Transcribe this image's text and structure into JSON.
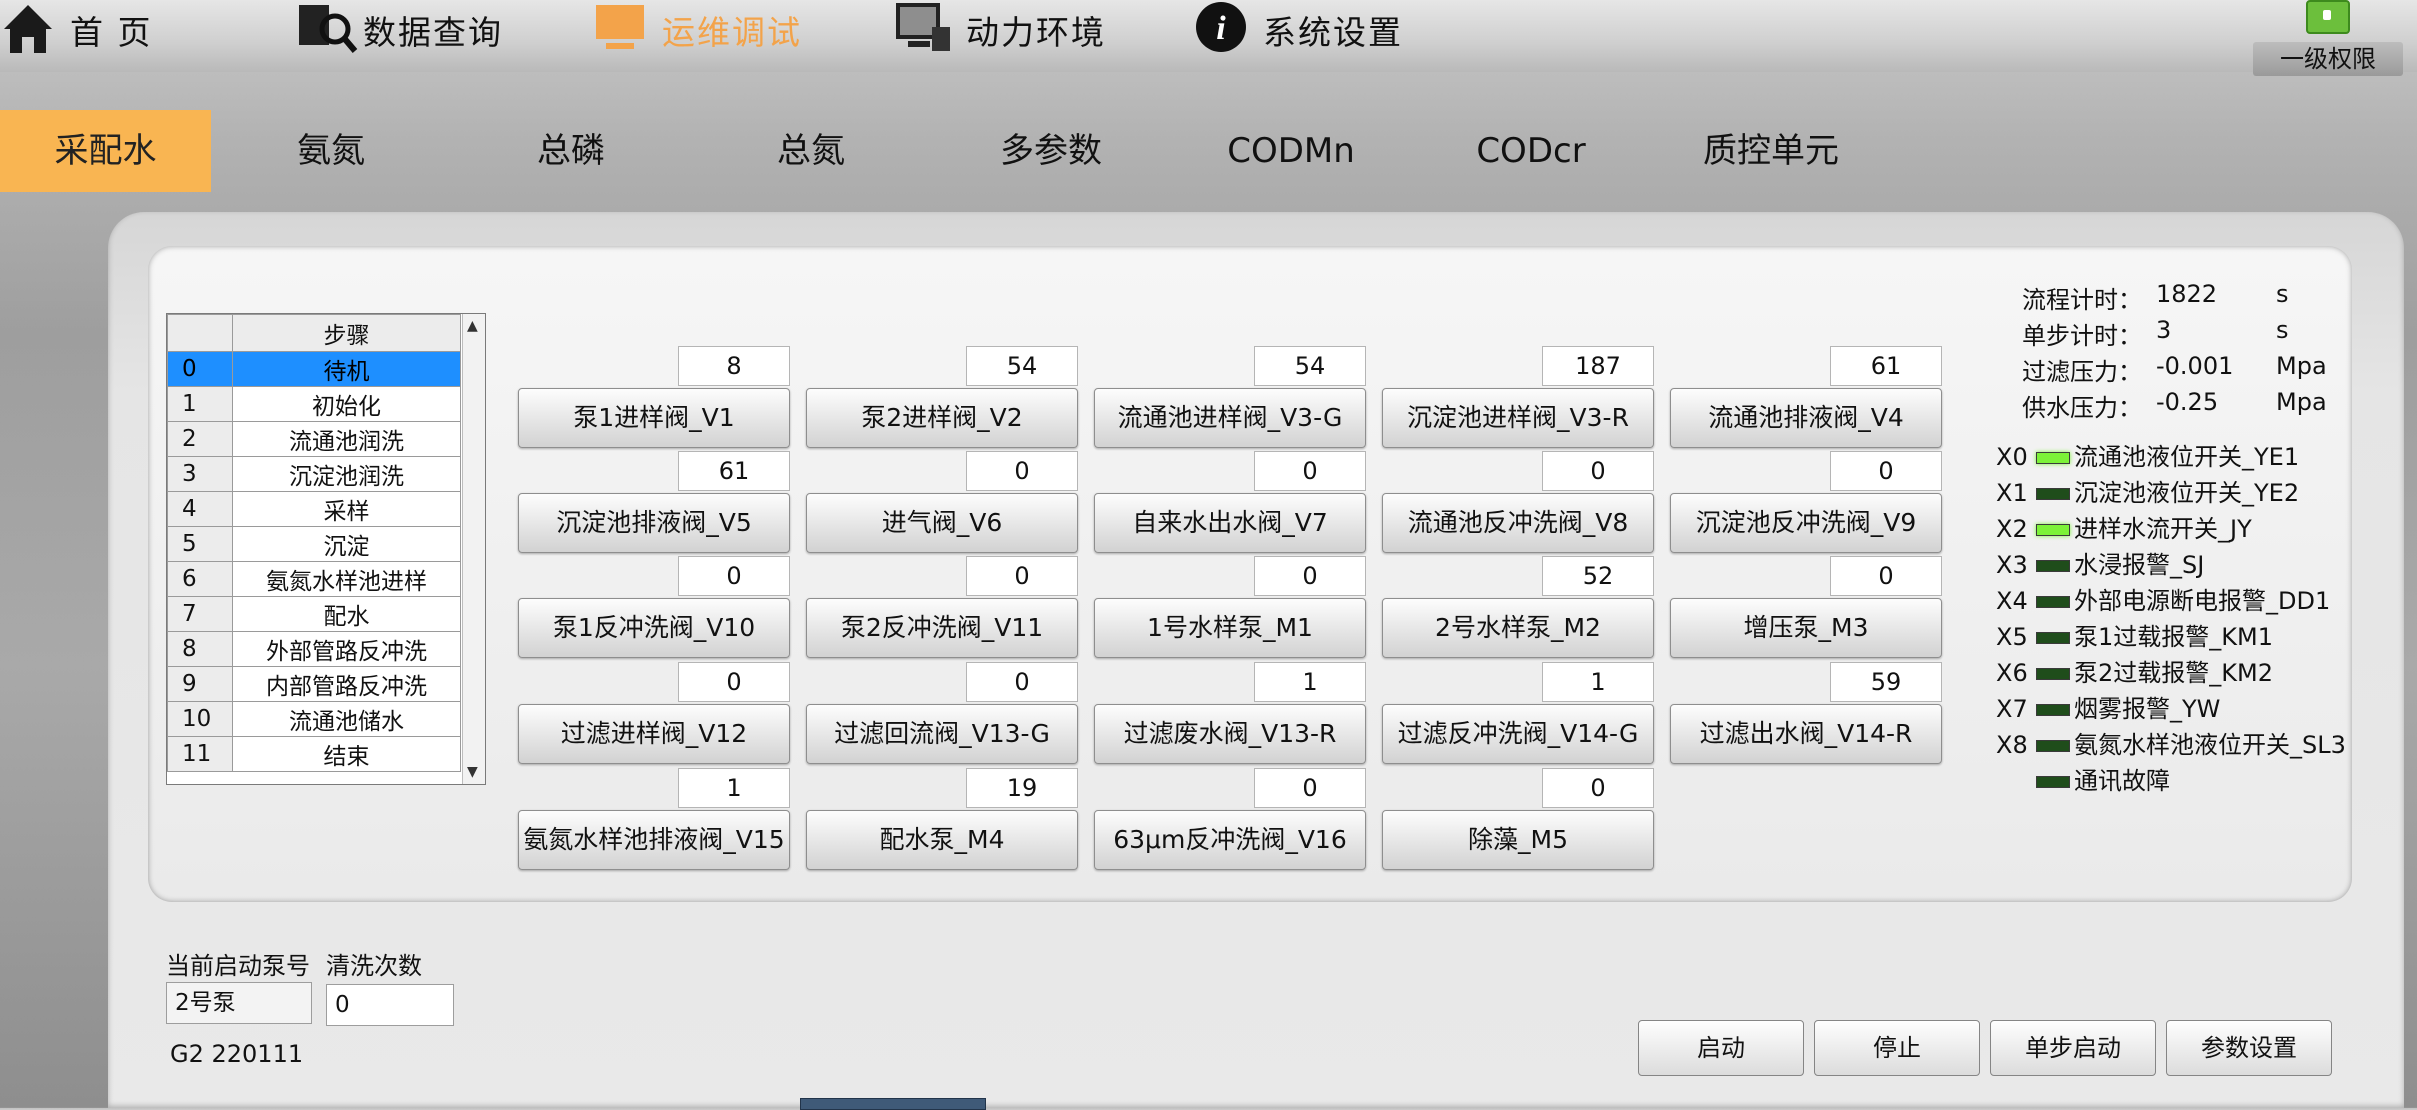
{
  "nav": {
    "items": [
      {
        "label": "首 页",
        "icon": "home-icon"
      },
      {
        "label": "数据查询",
        "icon": "data-search-icon"
      },
      {
        "label": "运维调试",
        "icon": "maintenance-icon",
        "active": true
      },
      {
        "label": "动力环境",
        "icon": "monitor-icon"
      },
      {
        "label": "系统设置",
        "icon": "info-icon"
      }
    ],
    "auth_label": "一级权限",
    "active_color": "#f3a34a"
  },
  "tabs": [
    "采配水",
    "氨氮",
    "总磷",
    "总氮",
    "多参数",
    "CODMn",
    "CODcr",
    "质控单元"
  ],
  "active_tab": "采配水",
  "steps": {
    "header": "步骤",
    "rows": [
      {
        "idx": "0",
        "name": "待机"
      },
      {
        "idx": "1",
        "name": "初始化"
      },
      {
        "idx": "2",
        "name": "流通池润洗"
      },
      {
        "idx": "3",
        "name": "沉淀池润洗"
      },
      {
        "idx": "4",
        "name": "采样"
      },
      {
        "idx": "5",
        "name": "沉淀"
      },
      {
        "idx": "6",
        "name": "氨氮水样池进样"
      },
      {
        "idx": "7",
        "name": "配水"
      },
      {
        "idx": "8",
        "name": "外部管路反冲洗"
      },
      {
        "idx": "9",
        "name": "内部管路反冲洗"
      },
      {
        "idx": "10",
        "name": "流通池储水"
      },
      {
        "idx": "11",
        "name": "结束"
      }
    ],
    "selected": "0",
    "selected_color": "#1e8fff"
  },
  "valves": [
    {
      "count": "8",
      "label": "泵1进样阀_V1"
    },
    {
      "count": "54",
      "label": "泵2进样阀_V2"
    },
    {
      "count": "54",
      "label": "流通池进样阀_V3-G"
    },
    {
      "count": "187",
      "label": "沉淀池进样阀_V3-R"
    },
    {
      "count": "61",
      "label": "流通池排液阀_V4"
    },
    {
      "count": "61",
      "label": "沉淀池排液阀_V5"
    },
    {
      "count": "0",
      "label": "进气阀_V6"
    },
    {
      "count": "0",
      "label": "自来水出水阀_V7"
    },
    {
      "count": "0",
      "label": "流通池反冲洗阀_V8"
    },
    {
      "count": "0",
      "label": "沉淀池反冲洗阀_V9"
    },
    {
      "count": "0",
      "label": "泵1反冲洗阀_V10"
    },
    {
      "count": "0",
      "label": "泵2反冲洗阀_V11"
    },
    {
      "count": "0",
      "label": "1号水样泵_M1"
    },
    {
      "count": "52",
      "label": "2号水样泵_M2"
    },
    {
      "count": "0",
      "label": "增压泵_M3"
    },
    {
      "count": "0",
      "label": "过滤进样阀_V12"
    },
    {
      "count": "0",
      "label": "过滤回流阀_V13-G"
    },
    {
      "count": "1",
      "label": "过滤废水阀_V13-R"
    },
    {
      "count": "1",
      "label": "过滤反冲洗阀_V14-G"
    },
    {
      "count": "59",
      "label": "过滤出水阀_V14-R"
    },
    {
      "count": "1",
      "label": "氨氮水样池排液阀_V15"
    },
    {
      "count": "19",
      "label": "配水泵_M4"
    },
    {
      "count": "0",
      "label": "63μm反冲洗阀_V16"
    },
    {
      "count": "0",
      "label": "除藻_M5"
    }
  ],
  "status": [
    {
      "label": "流程计时：",
      "value": "1822",
      "unit": "s"
    },
    {
      "label": "单步计时：",
      "value": "3",
      "unit": "s"
    },
    {
      "label": "过滤压力：",
      "value": "-0.001",
      "unit": "Mpa"
    },
    {
      "label": "供水压力：",
      "value": "-0.25",
      "unit": "Mpa"
    }
  ],
  "indicators": [
    {
      "code": "X0",
      "label": "流通池液位开关_YE1",
      "on": true
    },
    {
      "code": "X1",
      "label": "沉淀池液位开关_YE2",
      "on": false
    },
    {
      "code": "X2",
      "label": "进样水流开关_JY",
      "on": true
    },
    {
      "code": "X3",
      "label": "水浸报警_SJ",
      "on": false
    },
    {
      "code": "X4",
      "label": "外部电源断电报警_DD1",
      "on": false
    },
    {
      "code": "X5",
      "label": "泵1过载报警_KM1",
      "on": false
    },
    {
      "code": "X6",
      "label": "泵2过载报警_KM2",
      "on": false
    },
    {
      "code": "X7",
      "label": "烟雾报警_YW",
      "on": false
    },
    {
      "code": "X8",
      "label": "氨氮水样池液位开关_SL3",
      "on": false
    },
    {
      "code": "",
      "label": "通讯故障",
      "on": false
    }
  ],
  "led_colors": {
    "on": "#7cf238",
    "off": "#1f4d1b"
  },
  "bottom": {
    "pump_label": "当前启动泵号",
    "pump_value": "2号泵",
    "wash_label": "清洗次数",
    "wash_value": "0",
    "version": "G2 220111"
  },
  "actions": [
    "启动",
    "停止",
    "单步启动",
    "参数设置"
  ],
  "accent": "#f9b552"
}
